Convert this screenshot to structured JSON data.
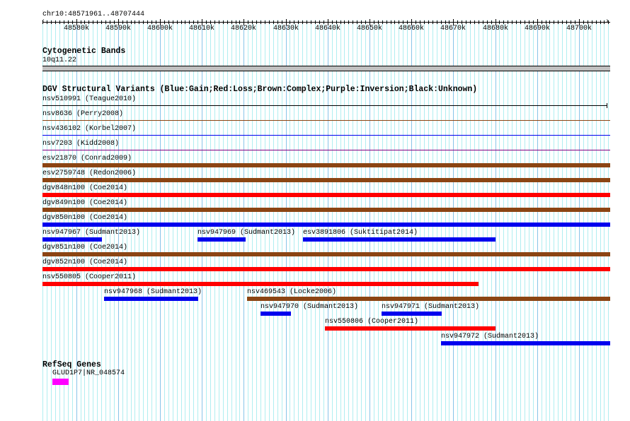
{
  "ruler": {
    "label": "chr10:48571961..48707444",
    "start": 48571961,
    "end": 48707444,
    "ticks": [
      "48580k",
      "48590k",
      "48600k",
      "48610k",
      "48620k",
      "48630k",
      "48640k",
      "48650k",
      "48660k",
      "48670k",
      "48680k",
      "48690k",
      "48700k"
    ]
  },
  "cyto": {
    "title": "Cytogenetic Bands",
    "band": "10q11.22"
  },
  "dgv": {
    "title": "DGV Structural Variants (Blue:Gain;Red:Loss;Brown:Complex;Purple:Inversion;Black:Unknown)",
    "colors": {
      "gain": "#0000ee",
      "loss": "#ff0000",
      "complex": "#8b4513",
      "inversion": "#800080",
      "unknown": "#000000"
    },
    "rows": [
      [
        {
          "name": "nsv510991 (Teague2010)",
          "type": "unknown",
          "start": 48571961,
          "end": 48706555,
          "thin": true
        }
      ],
      [
        {
          "name": "nsv8636 (Perry2008)",
          "type": "complex",
          "start": 48571961,
          "end": 48707444,
          "thin": true
        }
      ],
      [
        {
          "name": "nsv436102 (Korbel2007)",
          "type": "gain",
          "start": 48571961,
          "end": 48707444,
          "thin": true
        }
      ],
      [
        {
          "name": "nsv7203 (Kidd2008)",
          "type": "inversion",
          "start": 48571961,
          "end": 48707444,
          "thin": true
        }
      ],
      [
        {
          "name": "esv21870 (Conrad2009)",
          "type": "complex",
          "start": 48571961,
          "end": 48707444
        }
      ],
      [
        {
          "name": "esv2759748 (Redon2006)",
          "type": "complex",
          "start": 48571961,
          "end": 48707444
        }
      ],
      [
        {
          "name": "dgv848n100 (Coe2014)",
          "type": "loss",
          "start": 48571961,
          "end": 48707444
        }
      ],
      [
        {
          "name": "dgv849n100 (Coe2014)",
          "type": "complex",
          "start": 48571961,
          "end": 48707444
        }
      ],
      [
        {
          "name": "dgv850n100 (Coe2014)",
          "type": "gain",
          "start": 48571961,
          "end": 48707444
        }
      ],
      [
        {
          "name": "nsv947967 (Sudmant2013)",
          "type": "gain",
          "start": 48571961,
          "end": 48586182
        },
        {
          "name": "nsv947969 (Sudmant2013)",
          "type": "gain",
          "start": 48609038,
          "end": 48620550
        },
        {
          "name": "esv3891806 (Suktitipat2014)",
          "type": "gain",
          "start": 48634094,
          "end": 48679974
        }
      ],
      [
        {
          "name": "dgv851n100 (Coe2014)",
          "type": "complex",
          "start": 48571961,
          "end": 48707444
        }
      ],
      [
        {
          "name": "dgv852n100 (Coe2014)",
          "type": "loss",
          "start": 48571961,
          "end": 48707444
        }
      ],
      [
        {
          "name": "nsv550805 (Cooper2011)",
          "type": "loss",
          "start": 48571961,
          "end": 48676080
        }
      ],
      [
        {
          "name": "nsv947968 (Sudmant2013)",
          "type": "gain",
          "start": 48586690,
          "end": 48609207
        },
        {
          "name": "nsv469543 (Locke2006)",
          "type": "complex",
          "start": 48620719,
          "end": 48707444
        }
      ],
      [
        {
          "name": "nsv947970 (Sudmant2013)",
          "type": "gain",
          "start": 48623936,
          "end": 48631216
        },
        {
          "name": "nsv947971 (Sudmant2013)",
          "type": "gain",
          "start": 48652886,
          "end": 48667277
        }
      ],
      [
        {
          "name": "nsv550806 (Cooper2011)",
          "type": "loss",
          "start": 48639342,
          "end": 48679974
        }
      ],
      [
        {
          "name": "nsv947972 (Sudmant2013)",
          "type": "gain",
          "start": 48667108,
          "end": 48707444
        }
      ]
    ]
  },
  "refseq": {
    "title": "RefSeq Genes",
    "genes": [
      {
        "name": "GLUD1P7|NR_048574",
        "start": 48574331,
        "end": 48578225,
        "color": "#ff00ff"
      }
    ]
  }
}
